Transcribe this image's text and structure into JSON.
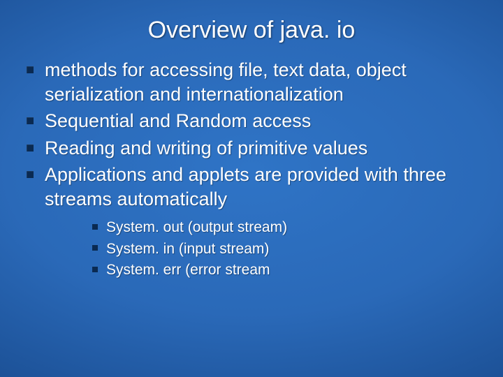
{
  "title": "Overview of java. io",
  "bullets": [
    "methods for accessing file, text data, object serialization and internationalization",
    "Sequential and Random access",
    "Reading and writing of primitive values",
    "Applications and applets are provided with three streams automatically"
  ],
  "sub_bullets": [
    "System. out (output stream)",
    "System. in (input stream)",
    "System. err (error stream"
  ]
}
